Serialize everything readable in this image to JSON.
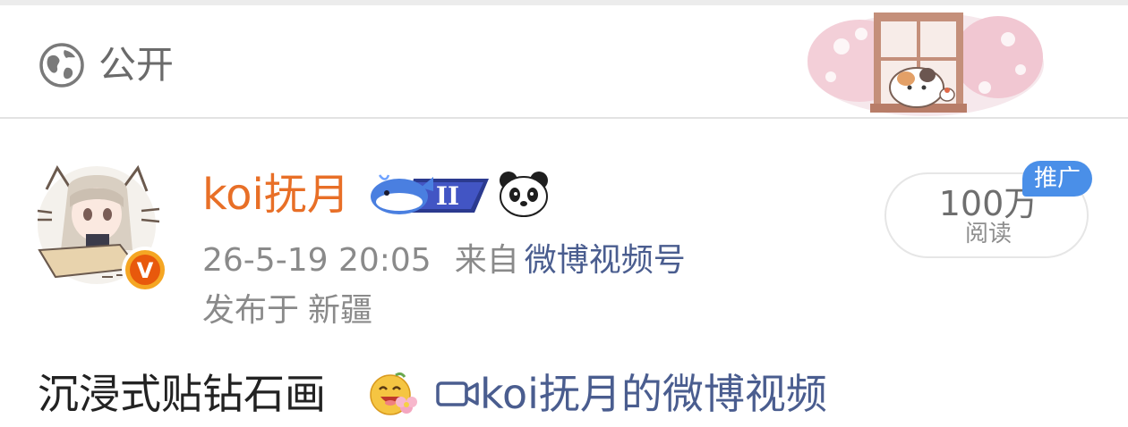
{
  "header": {
    "visibility_icon": "globe-icon",
    "visibility_label": "公开"
  },
  "post": {
    "author": {
      "name": "koi抚月",
      "avatar": "anime-cat-girl-avatar",
      "verified_badge": "V",
      "member_badge": {
        "icon": "whale-icon",
        "level": "II"
      },
      "fan_badge": "panda-icon"
    },
    "timestamp": "26-5-19 20:05",
    "from_label": "来自",
    "source": "微博视频号",
    "published_prefix": "发布于",
    "location": "新疆",
    "read_count": "100万",
    "read_label": "阅读",
    "promo_tag": "推广",
    "text": "沉浸式贴钻石画",
    "emoji": "smiling-flower-emoji",
    "video_link": "koi抚月的微博视频"
  },
  "colors": {
    "username": "#e86f27",
    "link": "#4a5d8f",
    "meta": "#8a8a8a",
    "promo_bg": "#4a8fe8",
    "divider": "#e3e3e3"
  }
}
